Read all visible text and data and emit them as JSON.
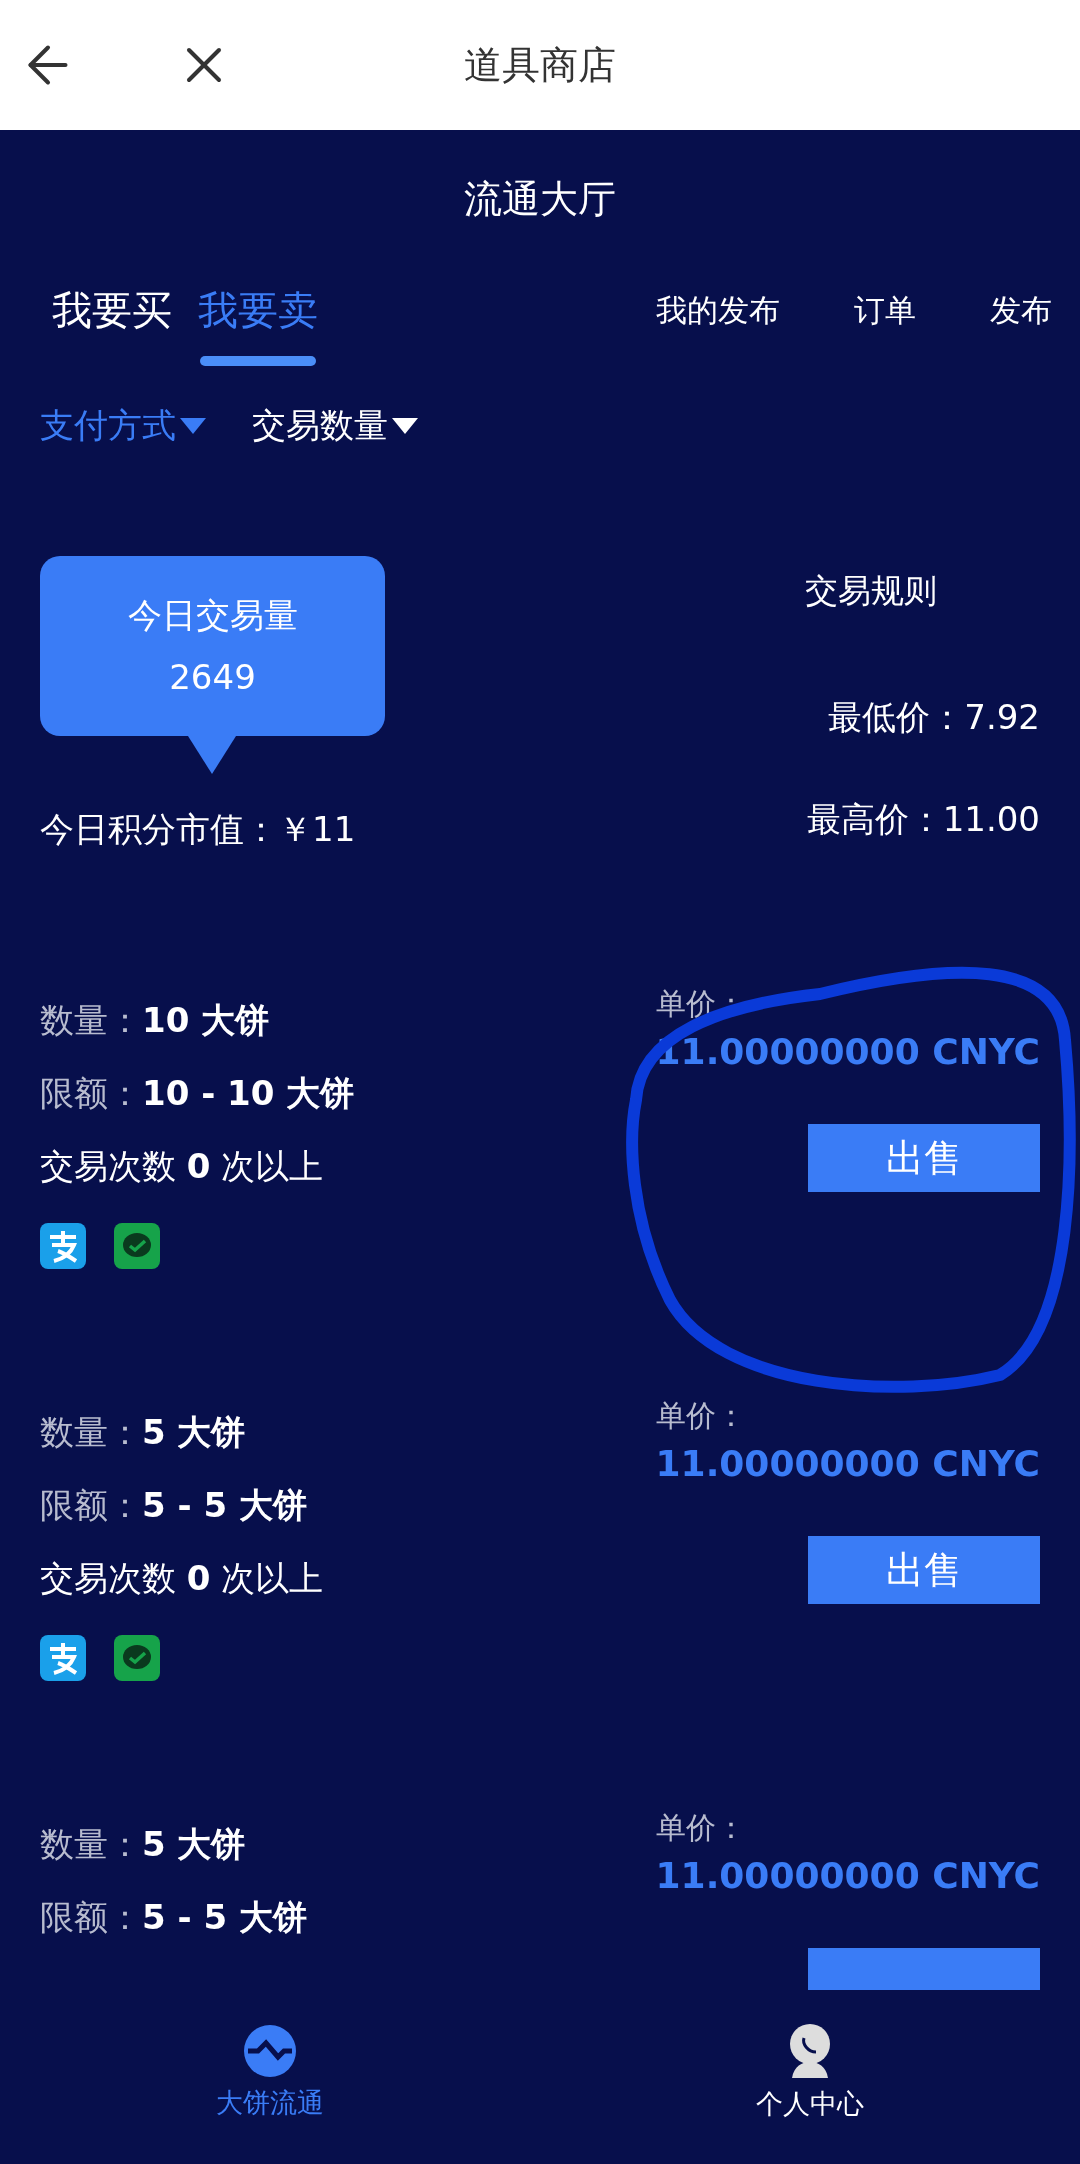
{
  "header": {
    "title": "道具商店"
  },
  "hall_title": "流通大厅",
  "tabs": [
    {
      "label": "我要买",
      "selected": false
    },
    {
      "label": "我要卖",
      "selected": true
    }
  ],
  "links": [
    "我的发布",
    "订单",
    "发布"
  ],
  "filters": [
    {
      "label": "支付方式",
      "selected": true
    },
    {
      "label": "交易数量",
      "selected": false
    }
  ],
  "stats": {
    "volume_title": "今日交易量",
    "volume": "2649",
    "market_value": "今日积分市值：￥11",
    "rules": "交易规则",
    "min_price": "最低价：7.92",
    "max_price": "最高价：11.00"
  },
  "listings": [
    {
      "kind": "full",
      "qty_label": "数量：",
      "qty": "10 大饼",
      "limit_label": "限额：",
      "limit": "10 - 10 大饼",
      "count": "交易次数 **0** 次以上",
      "payments": [
        {
          "kind": "alipay"
        },
        {
          "kind": "wechat"
        }
      ],
      "price_label": "单价：",
      "price": "11.00000000 CNYC",
      "button": "出售"
    },
    {
      "kind": "full",
      "qty_label": "数量：",
      "qty": "5 大饼",
      "limit_label": "限额：",
      "limit": "5 - 5 大饼",
      "count": "交易次数 **0** 次以上",
      "payments": [
        {
          "kind": "alipay"
        },
        {
          "kind": "wechat"
        }
      ],
      "price_label": "单价：",
      "price": "11.00000000 CNYC",
      "button": "出售"
    },
    {
      "kind": "cut",
      "qty_label": "数量：",
      "qty": "5 大饼",
      "limit_label": "限额：",
      "limit": "5 - 5 大饼",
      "price_label": "单价：",
      "price": "11.00000000 CNYC"
    }
  ],
  "nav": [
    {
      "kind": "wave",
      "label": "大饼流通",
      "selected": true
    },
    {
      "kind": "person",
      "label": "个人中心",
      "selected": false
    }
  ]
}
